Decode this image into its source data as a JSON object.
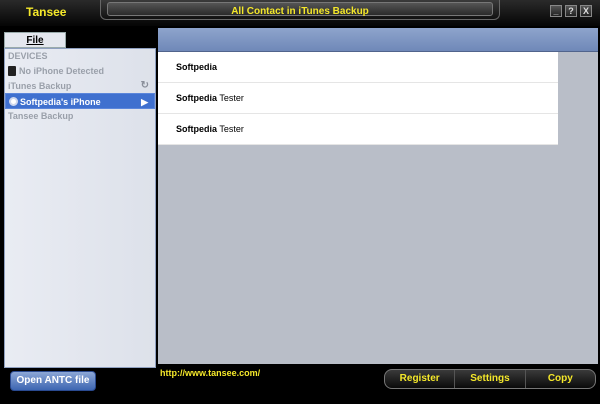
{
  "app": {
    "name": "Tansee",
    "window_title": "All Contact in iTunes Backup"
  },
  "window_buttons": [
    "_",
    "?",
    "X"
  ],
  "left_panel": {
    "file_tab": "File",
    "sections": {
      "devices": "DEVICES",
      "no_device": "No iPhone Detected",
      "itunes_backup": "iTunes Backup",
      "selected_device": "Softpedia's iPhone",
      "tansee_backup": "Tansee Backup"
    },
    "open_button": "Open ANTC file"
  },
  "contacts": [
    {
      "first": "Softpedia",
      "last": ""
    },
    {
      "first": "Softpedia",
      "last": "Tester"
    },
    {
      "first": "Softpedia",
      "last": "Tester"
    }
  ],
  "footer": {
    "link": "http://www.tansee.com/",
    "buttons": {
      "register": "Register",
      "settings": "Settings",
      "copy": "Copy"
    }
  }
}
